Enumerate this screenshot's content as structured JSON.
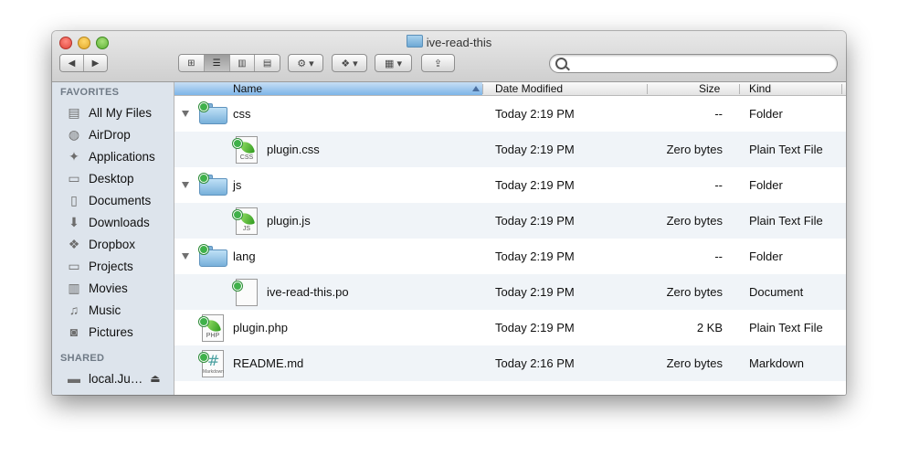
{
  "window": {
    "title": "ive-read-this"
  },
  "toolbar": {
    "nav": {
      "back": "◀",
      "forward": "▶"
    },
    "views": [
      {
        "icon": "icon-view-icon",
        "glyph": "⊞"
      },
      {
        "icon": "list-view-icon",
        "glyph": "☰"
      },
      {
        "icon": "column-view-icon",
        "glyph": "▥"
      },
      {
        "icon": "coverflow-view-icon",
        "glyph": "▤"
      }
    ],
    "action_glyph": "⚙ ▾",
    "dropbox_glyph": "❖ ▾",
    "arrange_glyph": "▦ ▾",
    "share_glyph": "⇪",
    "search": {
      "placeholder": "",
      "value": ""
    }
  },
  "sidebar": {
    "favorites_header": "FAVORITES",
    "favorites": [
      {
        "label": "All My Files",
        "icon": "all-files-icon",
        "glyph": "▤"
      },
      {
        "label": "AirDrop",
        "icon": "airdrop-icon",
        "glyph": "◍"
      },
      {
        "label": "Applications",
        "icon": "applications-icon",
        "glyph": "✦"
      },
      {
        "label": "Desktop",
        "icon": "desktop-icon",
        "glyph": "▭"
      },
      {
        "label": "Documents",
        "icon": "documents-icon",
        "glyph": "▯"
      },
      {
        "label": "Downloads",
        "icon": "downloads-icon",
        "glyph": "⬇"
      },
      {
        "label": "Dropbox",
        "icon": "dropbox-icon",
        "glyph": "❖"
      },
      {
        "label": "Projects",
        "icon": "folder-icon",
        "glyph": "▭"
      },
      {
        "label": "Movies",
        "icon": "movies-icon",
        "glyph": "▥"
      },
      {
        "label": "Music",
        "icon": "music-icon",
        "glyph": "♫"
      },
      {
        "label": "Pictures",
        "icon": "pictures-icon",
        "glyph": "◙"
      }
    ],
    "shared_header": "SHARED",
    "shared": [
      {
        "label": "local.Ju…",
        "icon": "network-drive-icon",
        "glyph": "▬",
        "eject": "⏏"
      }
    ]
  },
  "columns": {
    "name": "Name",
    "date": "Date Modified",
    "size": "Size",
    "kind": "Kind"
  },
  "rows": [
    {
      "name": "css",
      "date": "Today 2:19 PM",
      "size": "--",
      "kind": "Folder",
      "type": "folder",
      "level": 0,
      "expanded": true
    },
    {
      "name": "plugin.css",
      "date": "Today 2:19 PM",
      "size": "Zero bytes",
      "kind": "Plain Text File",
      "type": "doc",
      "ext": "CSS",
      "level": 1
    },
    {
      "name": "js",
      "date": "Today 2:19 PM",
      "size": "--",
      "kind": "Folder",
      "type": "folder",
      "level": 0,
      "expanded": true
    },
    {
      "name": "plugin.js",
      "date": "Today 2:19 PM",
      "size": "Zero bytes",
      "kind": "Plain Text File",
      "type": "doc",
      "ext": "JS",
      "level": 1
    },
    {
      "name": "lang",
      "date": "Today 2:19 PM",
      "size": "--",
      "kind": "Folder",
      "type": "folder",
      "level": 0,
      "expanded": true
    },
    {
      "name": "ive-read-this.po",
      "date": "Today 2:19 PM",
      "size": "Zero bytes",
      "kind": "Document",
      "type": "blank",
      "level": 1
    },
    {
      "name": "plugin.php",
      "date": "Today 2:19 PM",
      "size": "2 KB",
      "kind": "Plain Text File",
      "type": "doc",
      "ext": "PHP",
      "level": 0
    },
    {
      "name": "README.md",
      "date": "Today 2:16 PM",
      "size": "Zero bytes",
      "kind": "Markdown",
      "type": "markdown",
      "ext": "Markdown",
      "level": 0
    }
  ]
}
